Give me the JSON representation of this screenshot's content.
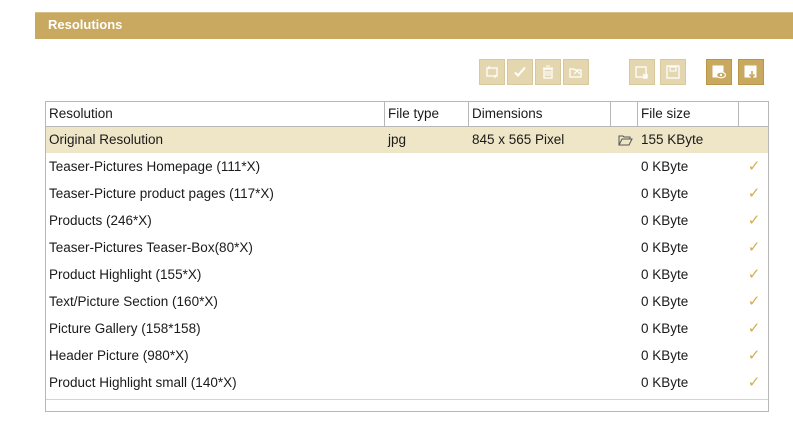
{
  "panel": {
    "title": "Resolutions"
  },
  "toolbar": {
    "buttons": [
      {
        "name": "crop-button",
        "icon": "crop-icon"
      },
      {
        "name": "apply-button",
        "icon": "check-icon"
      },
      {
        "name": "delete-button",
        "icon": "trash-icon"
      },
      {
        "name": "open-button",
        "icon": "folder-icon"
      },
      {
        "name": "export-button",
        "icon": "export-icon"
      },
      {
        "name": "save-button",
        "icon": "disk-icon"
      },
      {
        "name": "preview-button",
        "icon": "eye-icon"
      },
      {
        "name": "download-button",
        "icon": "download-icon"
      }
    ]
  },
  "table": {
    "headers": {
      "resolution": "Resolution",
      "file_type": "File type",
      "dimensions": "Dimensions",
      "file_size": "File size"
    },
    "rows": [
      {
        "resolution": "Original Resolution",
        "file_type": "jpg",
        "dimensions": "845 x 565 Pixel",
        "file_size": "155 KByte",
        "selected": true,
        "checked": false
      },
      {
        "resolution": "Teaser-Pictures Homepage (111*X)",
        "file_type": "",
        "dimensions": "",
        "file_size": "0 KByte",
        "selected": false,
        "checked": true
      },
      {
        "resolution": "Teaser-Picture product pages (117*X)",
        "file_type": "",
        "dimensions": "",
        "file_size": "0 KByte",
        "selected": false,
        "checked": true
      },
      {
        "resolution": "Products (246*X)",
        "file_type": "",
        "dimensions": "",
        "file_size": "0 KByte",
        "selected": false,
        "checked": true
      },
      {
        "resolution": "Teaser-Pictures Teaser-Box(80*X)",
        "file_type": "",
        "dimensions": "",
        "file_size": "0 KByte",
        "selected": false,
        "checked": true
      },
      {
        "resolution": "Product Highlight (155*X)",
        "file_type": "",
        "dimensions": "",
        "file_size": "0 KByte",
        "selected": false,
        "checked": true
      },
      {
        "resolution": "Text/Picture Section (160*X)",
        "file_type": "",
        "dimensions": "",
        "file_size": "0 KByte",
        "selected": false,
        "checked": true
      },
      {
        "resolution": "Picture Gallery (158*158)",
        "file_type": "",
        "dimensions": "",
        "file_size": "0 KByte",
        "selected": false,
        "checked": true
      },
      {
        "resolution": "Header Picture (980*X)",
        "file_type": "",
        "dimensions": "",
        "file_size": "0 KByte",
        "selected": false,
        "checked": true
      },
      {
        "resolution": "Product Highlight small (140*X)",
        "file_type": "",
        "dimensions": "",
        "file_size": "0 KByte",
        "selected": false,
        "checked": true
      }
    ],
    "check_glyph": "✓"
  },
  "colors": {
    "header_bg": "#c9a85f",
    "selected_row": "#efe6c8",
    "check": "#d3ae4d"
  }
}
